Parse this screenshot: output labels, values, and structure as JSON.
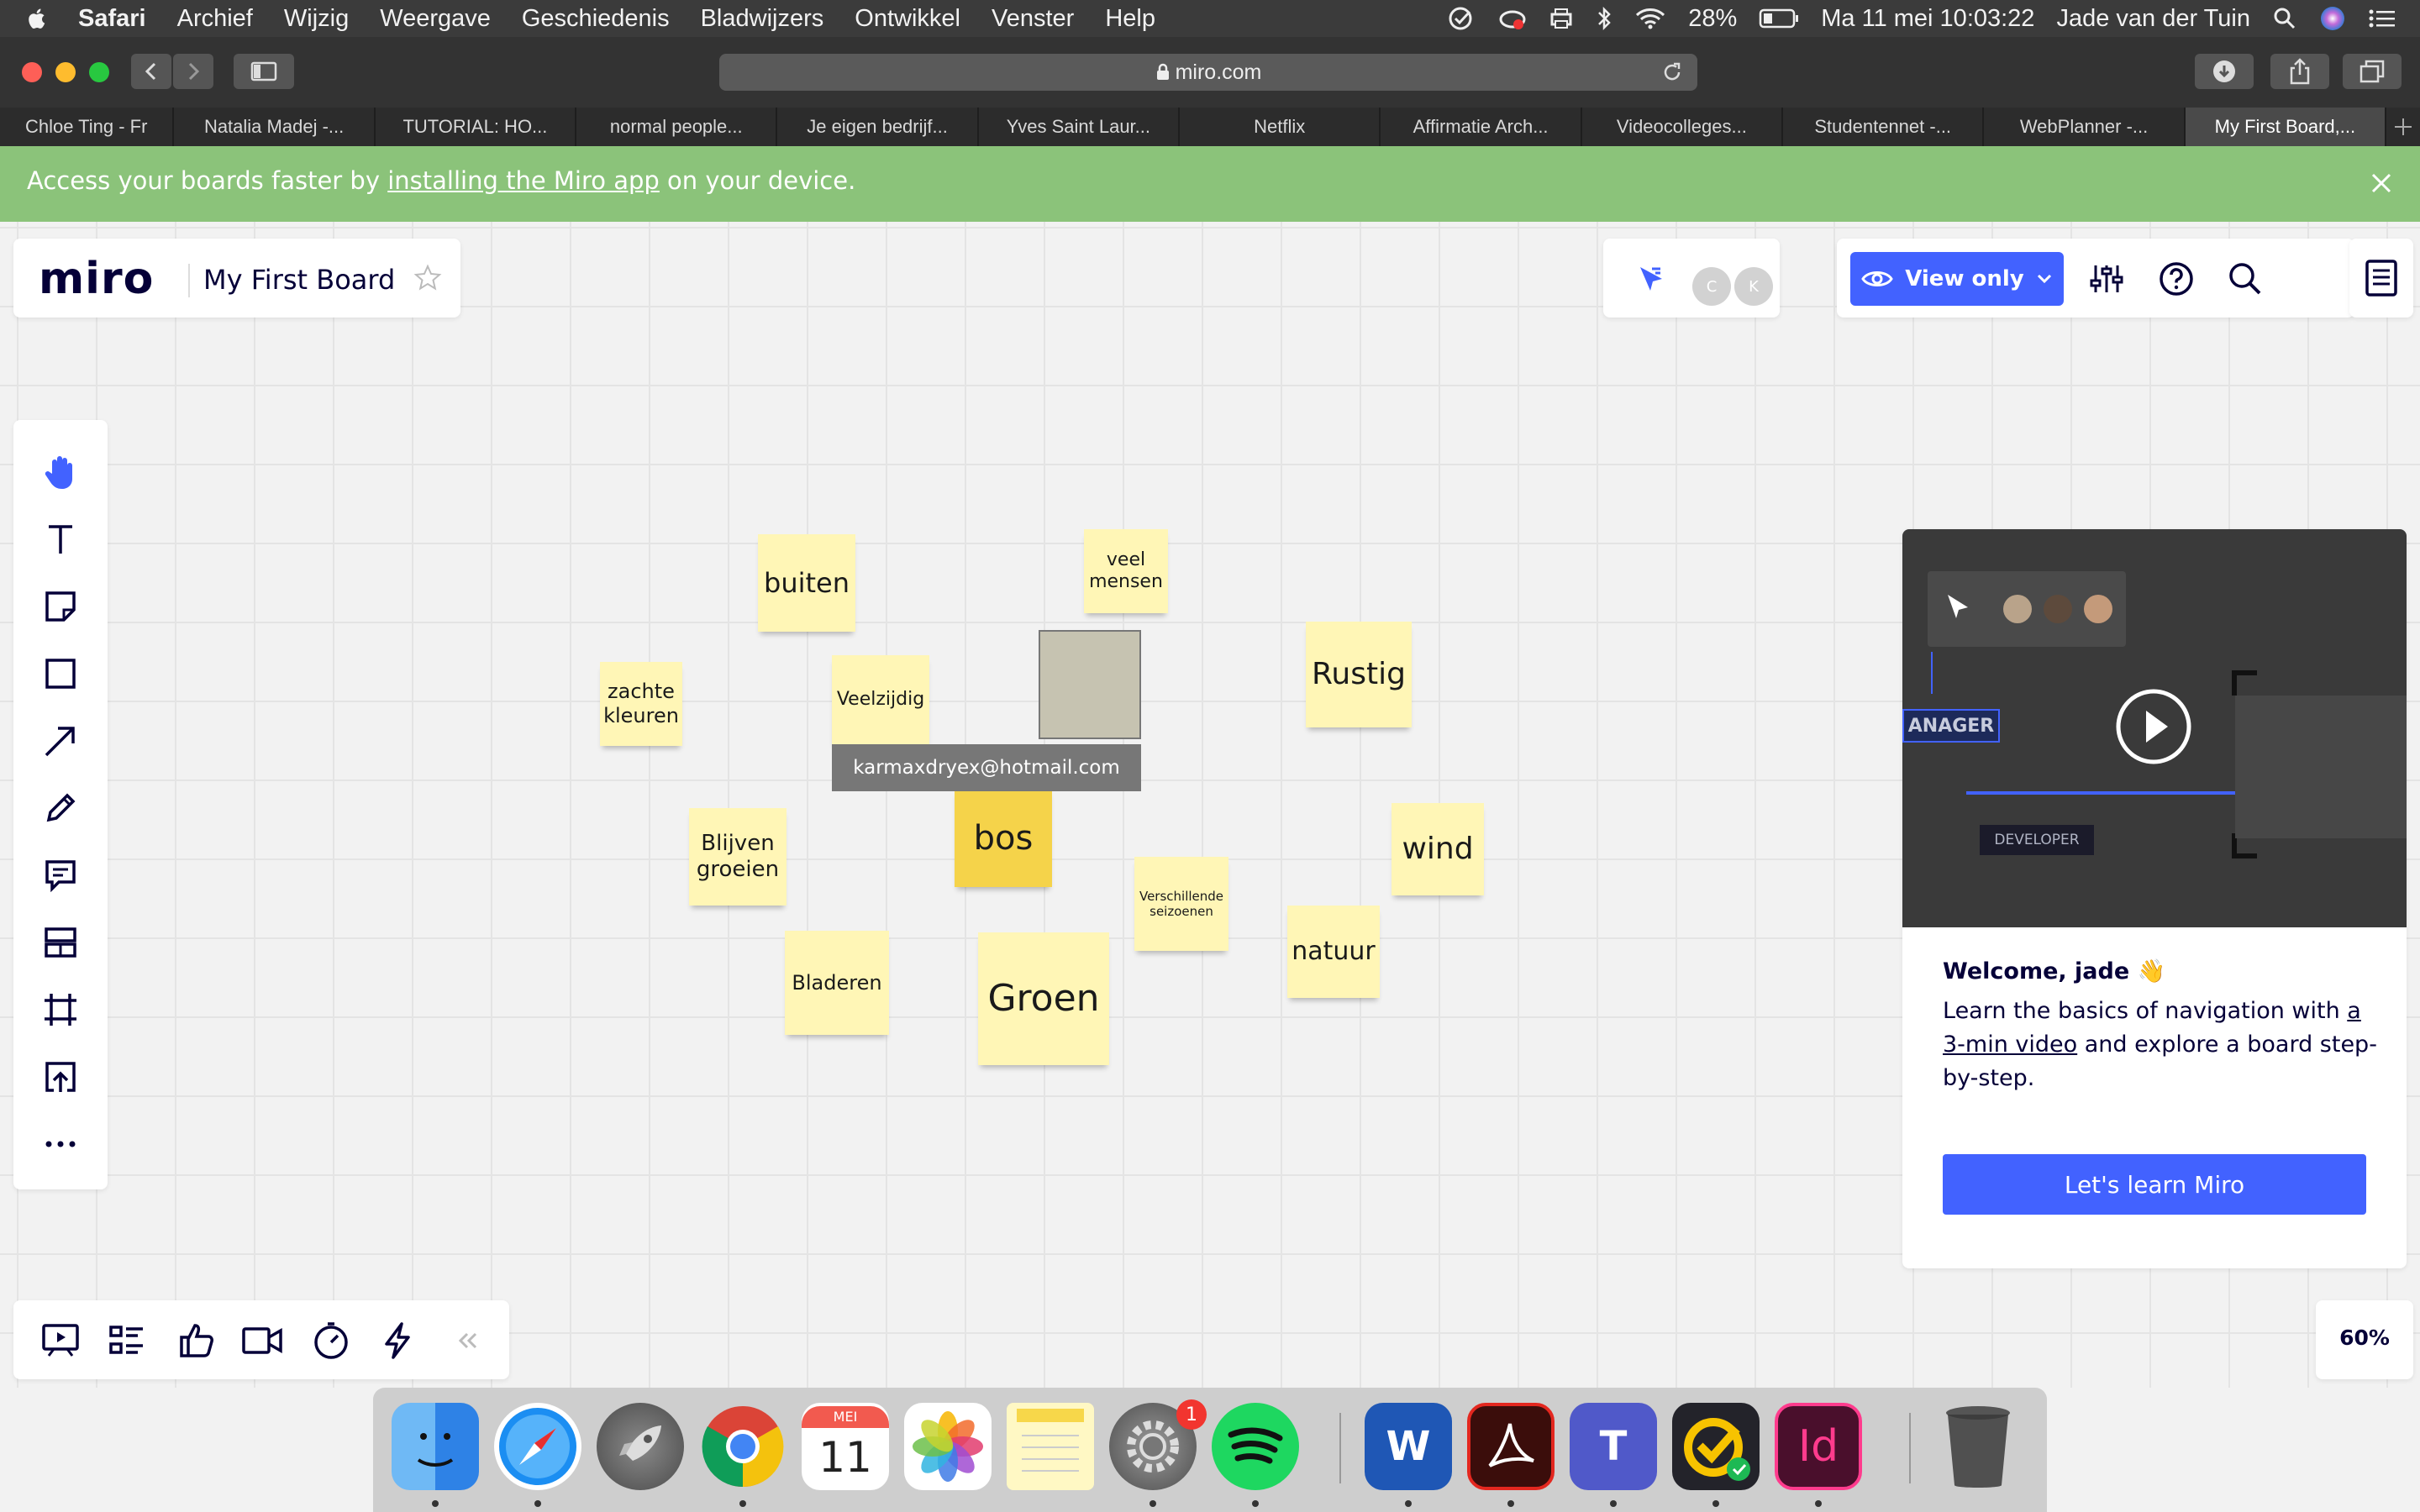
{
  "menubar": {
    "app": "Safari",
    "items": [
      "Archief",
      "Wijzig",
      "Weergave",
      "Geschiedenis",
      "Bladwijzers",
      "Ontwikkel",
      "Venster",
      "Help"
    ],
    "battery": "28%",
    "datetime": "Ma 11 mei  10:03:22",
    "user": "Jade van der Tuin"
  },
  "browser": {
    "url": "miro.com",
    "tabs": [
      "Chloe Ting - Fr",
      "Natalia Madej -...",
      "TUTORIAL: HO...",
      "normal people...",
      "Je eigen bedrijf...",
      "Yves Saint Laur...",
      "Netflix",
      "Affirmatie Arch...",
      "Videocolleges...",
      "Studentennet -...",
      "WebPlanner -...",
      "My First Board,..."
    ],
    "active_tab": 11
  },
  "banner": {
    "before": "Access your boards faster by ",
    "link": "installing the Miro app",
    "after": " on your device."
  },
  "board": {
    "logo": "miro",
    "title": "My First Board",
    "collaborators": [
      "C",
      "K"
    ],
    "view_only_label": "View only",
    "zoom": "60%"
  },
  "stickies": [
    {
      "text": "buiten",
      "color": "#fff6b6"
    },
    {
      "text": "veel\nmensen",
      "color": "#fff6b6"
    },
    {
      "text": "zachte\nkleuren",
      "color": "#fff6b6"
    },
    {
      "text": "Veelzijdig",
      "color": "#fff6b6"
    },
    {
      "text": "Rustig",
      "color": "#fff6b6"
    },
    {
      "text": "Blijven\ngroeien",
      "color": "#fff6b6"
    },
    {
      "text": "bos",
      "color": "#f5d34a"
    },
    {
      "text": "wind",
      "color": "#fff6b6"
    },
    {
      "text": "Verschillende\nseizoenen",
      "color": "#fff6b6"
    },
    {
      "text": "natuur",
      "color": "#fff6b6"
    },
    {
      "text": "Bladeren",
      "color": "#fff6b6"
    },
    {
      "text": "Groen",
      "color": "#fff6b6"
    }
  ],
  "cursor_tag": "karmaxdryex@hotmail.com",
  "welcome": {
    "video_labels": [
      "ANAGER",
      "DEVELOPER"
    ],
    "title": "Welcome, jade 👋",
    "body_before": "Learn the basics of navigation with ",
    "body_link": "a 3-min video",
    "body_after": " and explore a board step-by-step.",
    "button": "Let's learn Miro"
  },
  "dock": {
    "calendar_month": "MEI",
    "calendar_day": "11",
    "badge": "1",
    "word_letter": "W",
    "teams_letter": "T",
    "indesign_letters": "Id"
  }
}
